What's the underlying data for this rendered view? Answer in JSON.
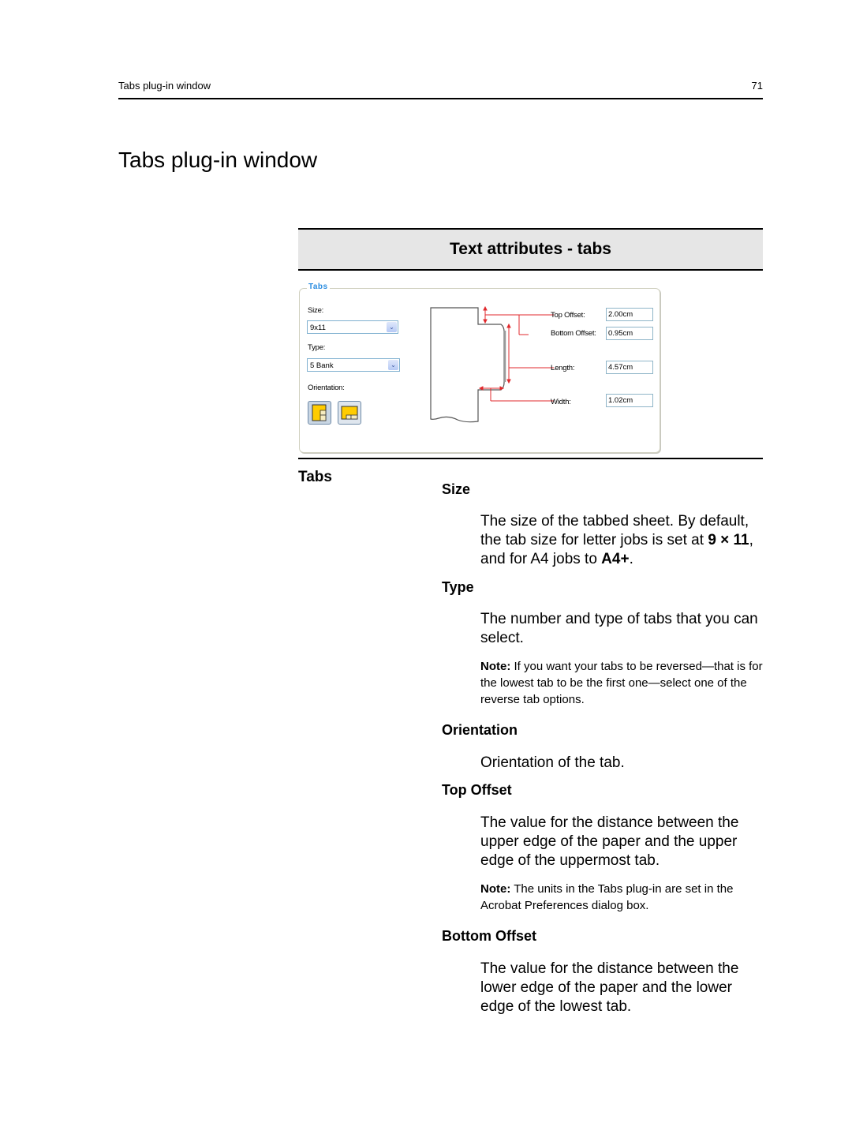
{
  "running_header": {
    "section": "Tabs plug-in window",
    "page_number": "71"
  },
  "page_title": "Tabs plug-in window",
  "figure": {
    "title": "Text attributes - tabs",
    "dialog": {
      "group_label": "Tabs",
      "size_label": "Size:",
      "size_value": "9x11",
      "type_label": "Type:",
      "type_value": "5 Bank",
      "orientation_label": "Orientation:",
      "orientation_options": [
        "portrait-tab-right",
        "landscape-tab-bottom"
      ],
      "orientation_selected": 0,
      "fields": [
        {
          "label": "Top Offset:",
          "value": "2.00cm"
        },
        {
          "label": "Bottom Offset:",
          "value": "0.95cm"
        },
        {
          "label": "Length:",
          "value": "4.57cm"
        },
        {
          "label": "Width:",
          "value": "1.02cm"
        }
      ],
      "colors": {
        "legend": "#2a8ce0",
        "dimension_lines": "#e0282c",
        "orientation_fill": "#ffcc00"
      }
    }
  },
  "table": {
    "row_label": "Tabs",
    "entries": [
      {
        "heading": "Size",
        "text_pre": "The size of the tabbed sheet. By default, the tab size for letter jobs is set at ",
        "bold1": "9 × 11",
        "text_mid": ", and for A4 jobs to ",
        "bold2": "A4+",
        "text_post": "."
      },
      {
        "heading": "Type",
        "text": "The number and type of tabs that you can select.",
        "note_label": "Note:",
        "note": " If you want your tabs to be reversed—that is for the lowest tab to be the first one—select one of the reverse tab options."
      },
      {
        "heading": "Orientation",
        "text": "Orientation of the tab."
      },
      {
        "heading": "Top Offset",
        "text": "The value for the distance between the upper edge of the paper and the upper edge of the uppermost tab.",
        "note_label": "Note:",
        "note": " The units in the Tabs plug-in are set in the Acrobat Preferences dialog box."
      },
      {
        "heading": "Bottom Offset",
        "text": "The value for the distance between the lower edge of the paper and the lower edge of the lowest tab."
      }
    ]
  }
}
